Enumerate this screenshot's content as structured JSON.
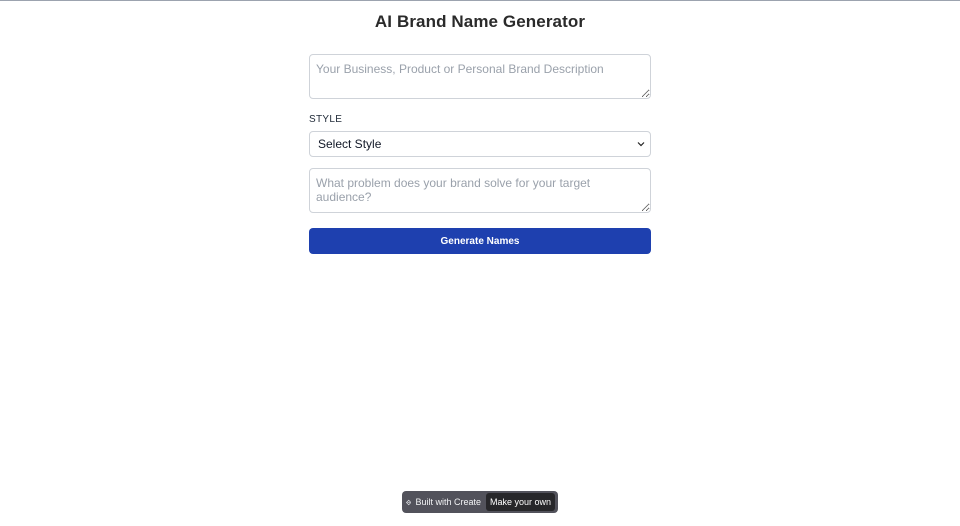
{
  "page": {
    "title": "AI Brand Name Generator"
  },
  "form": {
    "description_placeholder": "Your Business, Product or Personal Brand Description",
    "style_label": "STYLE",
    "style_selected": "Select Style",
    "problem_placeholder": "What problem does your brand solve for your target audience?",
    "generate_label": "Generate Names",
    "accent_color": "#1e40af"
  },
  "badge": {
    "built_with": "Built with Create",
    "make_your_own": "Make your own",
    "logo_icon": "create-logo-icon"
  }
}
